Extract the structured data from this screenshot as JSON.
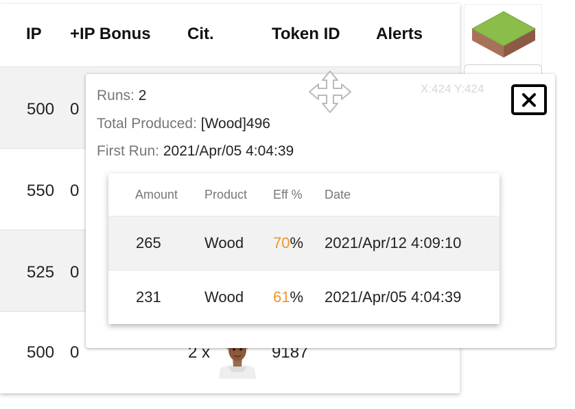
{
  "table": {
    "headers": [
      "IP",
      "+IP Bonus",
      "Cit.",
      "Token ID",
      "Alerts"
    ],
    "rows": [
      {
        "ip": "500",
        "bonus": "0"
      },
      {
        "ip": "550",
        "bonus": "0"
      },
      {
        "ip": "525",
        "bonus": "0"
      },
      {
        "ip": "500",
        "bonus": "0",
        "cit": "2 x",
        "token": "9187"
      }
    ]
  },
  "tile_icon": "grass-land-tile-icon",
  "popup": {
    "runs_label": "Runs: ",
    "runs_value": "2",
    "total_label": "Total Produced: ",
    "total_value": "[Wood]496",
    "first_label": "First Run: ",
    "first_value": "2021/Apr/05 4:04:39",
    "coords": "X:424 Y:424",
    "move_icon": "move-arrows-icon",
    "close_icon": "close-icon",
    "history": {
      "headers": [
        "Amount",
        "Product",
        "Eff %",
        "Date"
      ],
      "rows": [
        {
          "amount": "265",
          "product": "Wood",
          "eff": "70",
          "pct": "%",
          "date": "2021/Apr/12 4:09:10"
        },
        {
          "amount": "231",
          "product": "Wood",
          "eff": "61",
          "pct": "%",
          "date": "2021/Apr/05 4:04:39"
        }
      ]
    }
  },
  "colors": {
    "eff_accent": "#f29424",
    "row_alt": "#f2f2f2"
  }
}
